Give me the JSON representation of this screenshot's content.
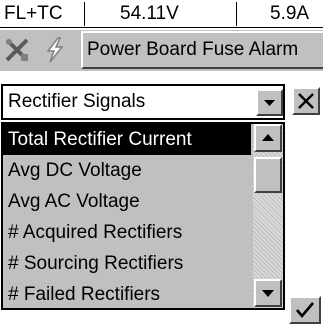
{
  "status": {
    "mode": "FL+TC",
    "voltage": "54.11V",
    "current": "5.9A"
  },
  "alarm": {
    "button_label": "Power Board Fuse Alarm"
  },
  "icons": {
    "left": "tools-icon",
    "right": "lightning-icon"
  },
  "dropdown": {
    "selected": "Rectifier Signals"
  },
  "list": {
    "items": [
      "Total Rectifier Current",
      "Avg DC Voltage",
      "Avg AC Voltage",
      "# Acquired Rectifiers",
      "# Sourcing Rectifiers",
      "# Failed Rectifiers"
    ],
    "selected_index": 0
  },
  "colors": {
    "panel": "#c0c0c0",
    "selection": "#000000"
  }
}
